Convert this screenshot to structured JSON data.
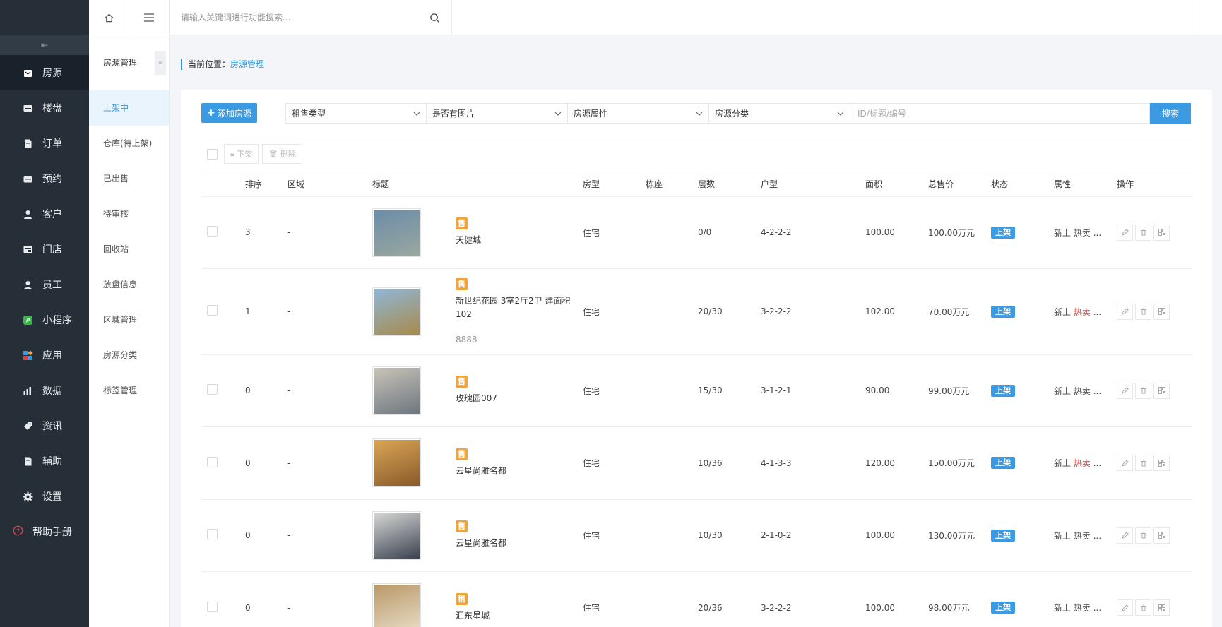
{
  "sidebar": {
    "collapse_glyph": "⇤",
    "items": [
      {
        "label": "房源",
        "icon": "house-icon",
        "active": true
      },
      {
        "label": "楼盘",
        "icon": "building-icon"
      },
      {
        "label": "订单",
        "icon": "order-icon"
      },
      {
        "label": "预约",
        "icon": "calendar-icon"
      },
      {
        "label": "客户",
        "icon": "customer-icon"
      },
      {
        "label": "门店",
        "icon": "store-icon"
      },
      {
        "label": "员工",
        "icon": "staff-icon"
      },
      {
        "label": "小程序",
        "icon": "miniprogram-icon"
      },
      {
        "label": "应用",
        "icon": "apps-icon"
      },
      {
        "label": "数据",
        "icon": "chart-icon"
      },
      {
        "label": "资讯",
        "icon": "tag-icon"
      },
      {
        "label": "辅助",
        "icon": "tool-icon"
      },
      {
        "label": "设置",
        "icon": "gear-icon"
      }
    ],
    "help": "帮助手册"
  },
  "subnav": {
    "title": "房源管理",
    "fold_glyph": "«",
    "items": [
      "上架中",
      "仓库(待上架)",
      "已出售",
      "待审核",
      "回收站",
      "放盘信息",
      "区域管理",
      "房源分类",
      "标签管理"
    ]
  },
  "topbar": {
    "search_placeholder": "请输入关键词进行功能搜索..."
  },
  "breadcrumb": {
    "prefix": "当前位置：",
    "current": "房源管理"
  },
  "toolbar": {
    "add_label": "添加房源",
    "filters": [
      "租售类型",
      "是否有图片",
      "房源属性",
      "房源分类"
    ],
    "keyword_placeholder": "ID/标题/编号",
    "search_label": "搜索",
    "off_label": "下架",
    "delete_label": "删除"
  },
  "table": {
    "headers": [
      "排序",
      "区域",
      "标题",
      "房型",
      "栋座",
      "层数",
      "户型",
      "面积",
      "总售价",
      "状态",
      "属性",
      "操作"
    ],
    "rows": [
      {
        "sort": "3",
        "area": "-",
        "tag": "售",
        "title": "天健城",
        "sub": "",
        "type": "住宅",
        "building": "",
        "floor": "0/0",
        "unit": "4-2-2-2",
        "size": "100.00",
        "price": "100.00万元",
        "status": "上架",
        "attr1": "新上",
        "attr2": "热卖",
        "attr_more": "...",
        "attr_hot": false,
        "img": [
          "#6a8ca8",
          "#9aa8a0"
        ]
      },
      {
        "sort": "1",
        "area": "-",
        "tag": "售",
        "title": "新世纪花园 3室2厅2卫 建面积102",
        "sub": "8888",
        "type": "住宅",
        "building": "",
        "floor": "20/30",
        "unit": "3-2-2-2",
        "size": "102.00",
        "price": "70.00万元",
        "status": "上架",
        "attr1": "新上",
        "attr2": "热卖",
        "attr_more": "...",
        "attr_hot": true,
        "img": [
          "#8fb7d9",
          "#a88a4a"
        ]
      },
      {
        "sort": "0",
        "area": "-",
        "tag": "售",
        "title": "玫瑰园007",
        "sub": "",
        "type": "住宅",
        "building": "",
        "floor": "15/30",
        "unit": "3-1-2-1",
        "size": "90.00",
        "price": "99.00万元",
        "status": "上架",
        "attr1": "新上",
        "attr2": "热卖",
        "attr_more": "...",
        "attr_hot": false,
        "img": [
          "#c9c4b8",
          "#6d7680"
        ]
      },
      {
        "sort": "0",
        "area": "-",
        "tag": "售",
        "title": "云星尚雅名都",
        "sub": "",
        "type": "住宅",
        "building": "",
        "floor": "10/36",
        "unit": "4-1-3-3",
        "size": "120.00",
        "price": "150.00万元",
        "status": "上架",
        "attr1": "新上",
        "attr2": "热卖",
        "attr_more": "...",
        "attr_hot": true,
        "img": [
          "#d9a656",
          "#8a5a2a"
        ]
      },
      {
        "sort": "0",
        "area": "-",
        "tag": "售",
        "title": "云星尚雅名都",
        "sub": "",
        "type": "住宅",
        "building": "",
        "floor": "10/30",
        "unit": "2-1-0-2",
        "size": "100.00",
        "price": "130.00万元",
        "status": "上架",
        "attr1": "新上",
        "attr2": "热卖",
        "attr_more": "...",
        "attr_hot": false,
        "img": [
          "#d8d8d6",
          "#3a4250"
        ]
      },
      {
        "sort": "0",
        "area": "-",
        "tag": "租",
        "title": "汇东星城",
        "sub": "",
        "type": "住宅",
        "building": "",
        "floor": "20/36",
        "unit": "3-2-2-2",
        "size": "100.00",
        "price": "98.00万元",
        "status": "上架",
        "attr1": "新上",
        "attr2": "热卖",
        "attr_more": "...",
        "attr_hot": false,
        "img": [
          "#b89868",
          "#e8dcc4"
        ]
      }
    ]
  },
  "colors": {
    "accent": "#3b9ae2",
    "sidebar_bg": "#262f38",
    "tag_orange": "#f2a33a",
    "hot_red": "#e24040"
  }
}
